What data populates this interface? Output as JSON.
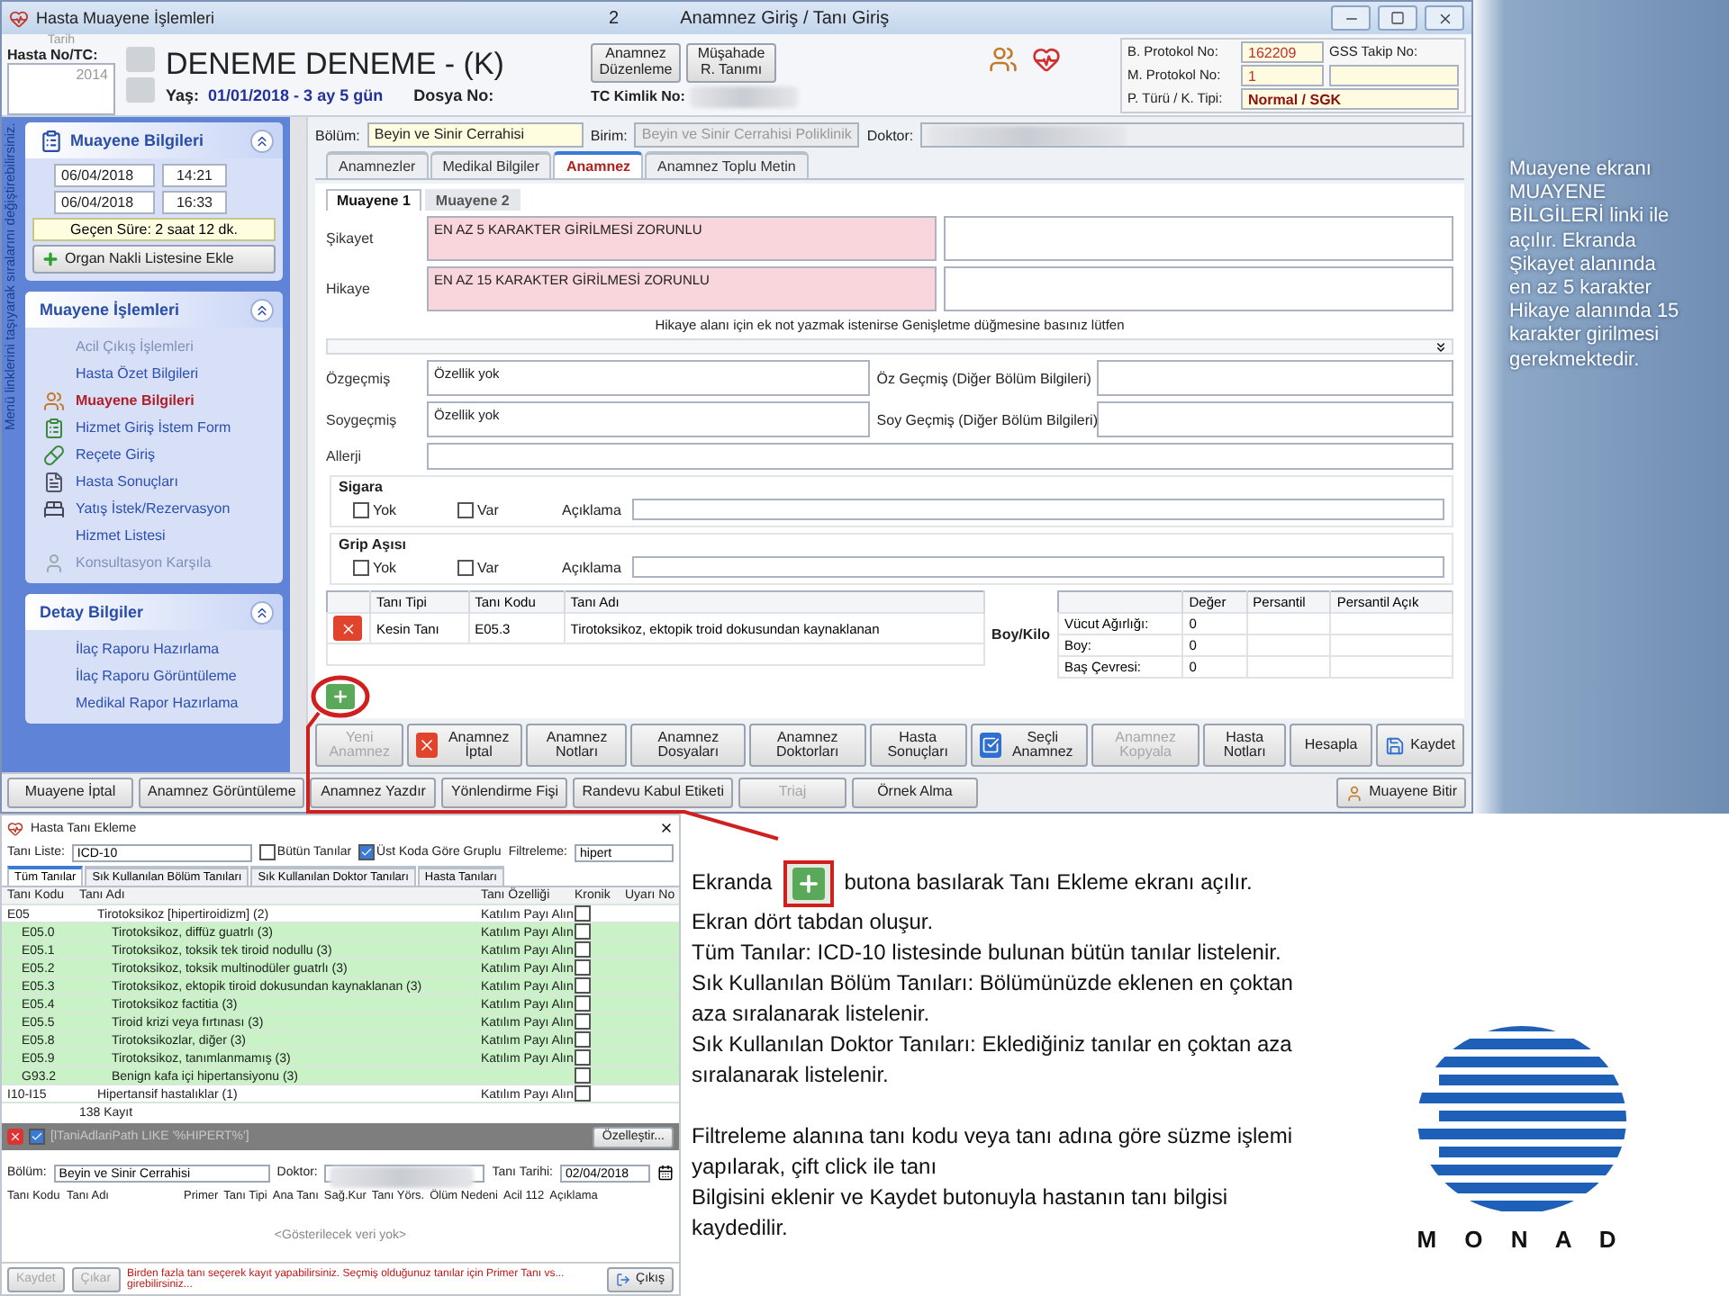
{
  "window": {
    "title": "Hasta Muayene İşlemleri",
    "number": "2",
    "caption": "Anamnez Giriş / Tanı Giriş"
  },
  "header": {
    "date_label": "Tarih",
    "patient_no_label": "Hasta No/TC:",
    "patient_no": "2014",
    "name": "DENEME DENEME - (K)",
    "age_label": "Yaş:",
    "age": "01/01/2018 - 3 ay 5 gün",
    "file_label": "Dosya No:",
    "tc_label": "TC Kimlik No:",
    "buttons": [
      "Anamnez Düzenleme",
      "Müşahade R. Tanımı"
    ],
    "protocol": [
      {
        "label": "B. Protokol No:",
        "value": "162209"
      },
      {
        "label": "M. Protokol No:",
        "value": "1"
      },
      {
        "label": "P. Türü / K. Tipi:",
        "value": "Normal / SGK"
      }
    ],
    "gss_label": "GSS Takip No:"
  },
  "sidebar": {
    "hint": "Menü linklerini taşıyarak sıralarını değiştirebilirsiniz.",
    "info_panel": {
      "title": "Muayene Bilgileri",
      "times": [
        {
          "date": "06/04/2018",
          "time": "14:21"
        },
        {
          "date": "06/04/2018",
          "time": "16:33"
        }
      ],
      "elapsed": "Geçen Süre: 2 saat 12 dk.",
      "button": "Organ Nakli Listesine Ekle"
    },
    "menu_panels": [
      {
        "title": "Muayene İşlemleri",
        "items": [
          {
            "label": "Acil Çıkış İşlemleri",
            "kind": "plain",
            "selected": false,
            "disabled": true
          },
          {
            "label": "Hasta Özet Bilgileri",
            "kind": "plain",
            "selected": false,
            "disabled": false
          },
          {
            "label": "Muayene Bilgileri",
            "kind": "people",
            "selected": true,
            "disabled": false
          },
          {
            "label": "Hizmet Giriş İstem Form",
            "kind": "form",
            "selected": false,
            "disabled": false
          },
          {
            "label": "Reçete Giriş",
            "kind": "pill",
            "selected": false,
            "disabled": false
          },
          {
            "label": "Hasta Sonuçları",
            "kind": "doc",
            "selected": false,
            "disabled": false
          },
          {
            "label": "Yatış İstek/Rezervasyon",
            "kind": "bed",
            "selected": false,
            "disabled": false
          },
          {
            "label": "Hizmet Listesi",
            "kind": "plain",
            "selected": false,
            "disabled": false
          },
          {
            "label": "Konsultasyon Karşıla",
            "kind": "person",
            "selected": false,
            "disabled": true
          }
        ]
      },
      {
        "title": "Detay Bilgiler",
        "items": [
          {
            "label": "İlaç Raporu Hazırlama",
            "kind": "plain",
            "selected": false,
            "disabled": false
          },
          {
            "label": "İlaç Raporu Görüntüleme",
            "kind": "plain",
            "selected": false,
            "disabled": false
          },
          {
            "label": "Medikal Rapor Hazırlama",
            "kind": "plain",
            "selected": false,
            "disabled": false
          }
        ]
      }
    ]
  },
  "main": {
    "section_label": "Bölüm:",
    "section": "Beyin ve Sinir Cerrahisi",
    "unit_label": "Birim:",
    "unit": "Beyin ve Sinir Cerrahisi Poliklinik",
    "doctor_label": "Doktor:",
    "tabs": [
      {
        "label": "Anamnezler",
        "selected": false
      },
      {
        "label": "Medikal Bilgiler",
        "selected": false
      },
      {
        "label": "Anamnez",
        "selected": true
      },
      {
        "label": "Anamnez Toplu Metin",
        "selected": false
      }
    ],
    "subtabs": [
      {
        "label": "Muayene 1",
        "selected": true
      },
      {
        "label": "Muayene 2",
        "selected": false
      }
    ],
    "complaints": [
      {
        "label": "Şikayet",
        "value": "EN AZ 5 KARAKTER GİRİLMESİ ZORUNLU",
        "required": true
      },
      {
        "label": "Hikaye",
        "value": "EN AZ 15 KARAKTER GİRİLMESİ ZORUNLU",
        "required": true
      }
    ],
    "hint": "Hikaye alanı için ek not yazmak istenirse Genişletme düğmesine basınız lütfen",
    "history": [
      {
        "label": "Özgeçmiş",
        "value": "Özellik yok",
        "other_label": "Öz Geçmiş (Diğer Bölüm Bilgileri)"
      },
      {
        "label": "Soygeçmiş",
        "value": "Özellik yok",
        "other_label": "Soy Geçmiş (Diğer Bölüm Bilgileri)"
      }
    ],
    "allergy_label": "Allerji",
    "habits": [
      {
        "title": "Sigara",
        "options": [
          {
            "label": "Yok",
            "checked": false
          },
          {
            "label": "Var",
            "checked": false
          }
        ],
        "note_label": "Açıklama"
      },
      {
        "title": "Grip Aşısı",
        "options": [
          {
            "label": "Yok",
            "checked": false
          },
          {
            "label": "Var",
            "checked": false
          }
        ],
        "note_label": "Açıklama"
      }
    ],
    "diagnoses": {
      "columns": [
        "Tanı Tipi",
        "Tanı Kodu",
        "Tanı Adı"
      ],
      "rows": [
        [
          "Kesin Tanı",
          "E05.3",
          "Tirotoksikoz, ektopik troid dokusundan kaynaklanan"
        ]
      ]
    },
    "measures": {
      "label": "Boy/Kilo",
      "columns": [
        "Değer",
        "Persantil",
        "Persantil Açık"
      ],
      "rows": [
        {
          "name": "Vücut Ağırlığı:",
          "value": "0"
        },
        {
          "name": "Boy:",
          "value": "0"
        },
        {
          "name": "Baş Çevresi:",
          "value": "0"
        }
      ]
    },
    "actions": [
      {
        "label": "Yeni Anamnez",
        "disabled": true,
        "kind": "plain"
      },
      {
        "label": "Anamnez İptal",
        "disabled": false,
        "kind": "delete"
      },
      {
        "label": "Anamnez Notları",
        "disabled": false,
        "kind": "plain"
      },
      {
        "label": "Anamnez Dosyaları",
        "disabled": false,
        "kind": "plain"
      },
      {
        "label": "Anamnez Doktorları",
        "disabled": false,
        "kind": "plain"
      },
      {
        "label": "Hasta Sonuçları",
        "disabled": false,
        "kind": "plain"
      },
      {
        "label": "Seçli Anamnez",
        "disabled": false,
        "kind": "select"
      },
      {
        "label": "Anamnez Kopyala",
        "disabled": true,
        "kind": "plain"
      },
      {
        "label": "Hasta Notları",
        "disabled": false,
        "kind": "plain"
      },
      {
        "label": "Hesapla",
        "disabled": false,
        "kind": "plain"
      }
    ],
    "save": "Kaydet"
  },
  "bottom_bar": {
    "buttons": [
      {
        "label": "Muayene İptal",
        "disabled": false
      },
      {
        "label": "Anamnez Görüntüleme",
        "disabled": false
      },
      {
        "label": "Anamnez Yazdır",
        "disabled": false
      },
      {
        "label": "Yönlendirme Fişi",
        "disabled": false
      },
      {
        "label": "Randevu Kabul Etiketi",
        "disabled": false
      },
      {
        "label": "Triaj",
        "disabled": true
      },
      {
        "label": "Örnek Alma",
        "disabled": false
      }
    ],
    "finish": "Muayene Bitir"
  },
  "note": "Muayene ekranı MUAYENE BİLGİLERİ linki ile açılır. Ekranda Şikayet alanında en az 5 karakter Hikaye alanında 15 karakter girilmesi gerekmektedir.",
  "dialog": {
    "title": "Hasta Tanı Ekleme",
    "list_label": "Tanı Liste:",
    "list": "ICD-10",
    "options": [
      {
        "label": "Bütün Tanılar",
        "checked": false
      },
      {
        "label": "Üst Koda Göre Gruplu",
        "checked": true
      }
    ],
    "filter_label": "Filtreleme:",
    "filter": "hipert",
    "tabs": [
      {
        "label": "Tüm Tanılar",
        "selected": true
      },
      {
        "label": "Sık Kullanılan Bölüm Tanıları",
        "selected": false
      },
      {
        "label": "Sık Kullanılan Doktor Tanıları",
        "selected": false
      },
      {
        "label": "Hasta Tanıları",
        "selected": false
      }
    ],
    "columns": [
      "Tanı Kodu",
      "Tanı Adı",
      "Tanı Özelliği",
      "Kronik",
      "Uyarı No"
    ],
    "rows": [
      {
        "code": "E05",
        "name": "Tirotoksikoz [hipertiroidizm] (2)",
        "feature": "Katılım Payı Alın",
        "chronic": false,
        "children": [
          {
            "code": "E05.0",
            "name": "Tirotoksikoz, diffüz guatrlı (3)",
            "feature": "Katılım Payı Alın",
            "chronic": false
          },
          {
            "code": "E05.1",
            "name": "Tirotoksikoz, toksik tek tiroid nodullu (3)",
            "feature": "Katılım Payı Alın",
            "chronic": false
          },
          {
            "code": "E05.2",
            "name": "Tirotoksikoz, toksik multinodüler guatrlı (3)",
            "feature": "Katılım Payı Alın",
            "chronic": false
          },
          {
            "code": "E05.3",
            "name": "Tirotoksikoz, ektopik tiroid dokusundan kaynaklanan (3)",
            "feature": "Katılım Payı Alın",
            "chronic": false
          },
          {
            "code": "E05.4",
            "name": "Tirotoksikoz factitia (3)",
            "feature": "Katılım Payı Alın",
            "chronic": false
          },
          {
            "code": "E05.5",
            "name": "Tiroid krizi veya fırtınası (3)",
            "feature": "Katılım Payı Alın",
            "chronic": false
          },
          {
            "code": "E05.8",
            "name": "Tirotoksikozlar, diğer (3)",
            "feature": "Katılım Payı Alın",
            "chronic": false
          },
          {
            "code": "E05.9",
            "name": "Tirotoksikoz, tanımlanmamış (3)",
            "feature": "Katılım Payı Alın",
            "chronic": false
          },
          {
            "code": "G93.2",
            "name": "Benign kafa içi hipertansiyonu (3)",
            "chronic": false
          }
        ]
      },
      {
        "code": "I10-I15",
        "name": "Hipertansif hastalıklar (1)",
        "feature": "Katılım Payı Alın",
        "chronic": false
      }
    ],
    "count": "138 Kayıt",
    "filter_enabled": true,
    "filter_expr": "[lTaniAdlariPath LIKE '%HIPERT%']",
    "customize": "Özelleştir...",
    "section_label": "Bölüm:",
    "section": "Beyin ve Sinir Cerrahisi",
    "doctor_label": "Doktor:",
    "date_label": "Tanı Tarihi:",
    "date": "02/04/2018",
    "columns2": [
      "Tanı Kodu",
      "Tanı Adı",
      "Primer",
      "Tanı Tipi",
      "Ana Tanı",
      "Sağ.Kur",
      "Tanı Yörs.",
      "Ölüm Nedeni",
      "Acil 112",
      "Açıklama"
    ],
    "empty": "<Gösterilecek veri yok>",
    "footer": [
      {
        "label": "Kaydet",
        "disabled": true
      },
      {
        "label": "Çıkar",
        "disabled": true
      }
    ],
    "message": "Birden fazla tanı seçerek kayıt yapabilirsiniz. Seçmiş olduğunuz tanılar için Primer Tanı vs... girebilirsiniz...",
    "exit": "Çıkış"
  },
  "instructions": {
    "lead": "Ekranda",
    "lead_rest": "butona basılarak Tanı Ekleme ekranı açılır.",
    "blocks": [
      [
        "Ekran dört tabdan oluşur.",
        "Tüm Tanılar: ICD-10 listesinde bulunan bütün tanılar listelenir.",
        "Sık Kullanılan Bölüm Tanıları: Bölümünüzde eklenen en çoktan aza sıralanarak listelenir.",
        "Sık Kullanılan Doktor Tanıları: Eklediğiniz tanılar en çoktan aza sıralanarak listelenir."
      ],
      [
        "Filtreleme alanına tanı kodu veya tanı adına göre süzme işlemi yapılarak, çift click ile tanı",
        "Bilgisini eklenir ve Kaydet butonuyla hastanın tanı bilgisi kaydedilir."
      ]
    ]
  },
  "logo": {
    "letters": "M O N A D"
  }
}
